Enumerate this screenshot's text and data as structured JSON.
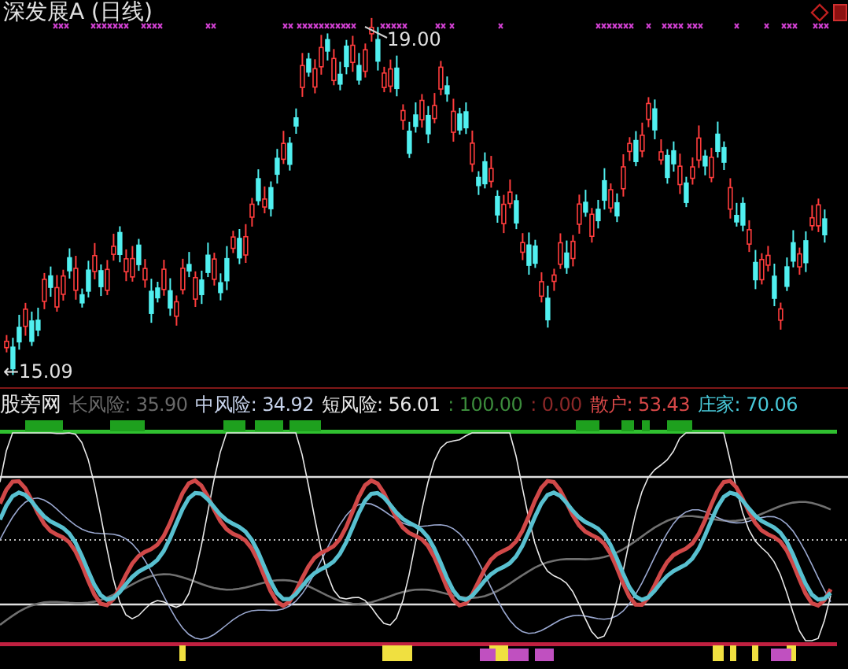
{
  "price_chart": {
    "title": "深发展A (日线)",
    "high_label": "19.00",
    "low_label": "←15.09"
  },
  "indicator": {
    "name": "股旁网",
    "readings": [
      {
        "text": "长风险: 35.90",
        "color": "#6a6a6a"
      },
      {
        "text": "中风险: 34.92",
        "color": "#c8d4ec"
      },
      {
        "text": "短风险: 56.01",
        "color": "#e8e8e8"
      },
      {
        "text": ": 100.00",
        "color": "#3c8c3c"
      },
      {
        "text": ": 0.00",
        "color": "#8c2828"
      },
      {
        "text": "散户: 53.43",
        "color": "#d84848"
      },
      {
        "text": "庄家: 70.06",
        "color": "#48c8d8"
      }
    ]
  }
}
